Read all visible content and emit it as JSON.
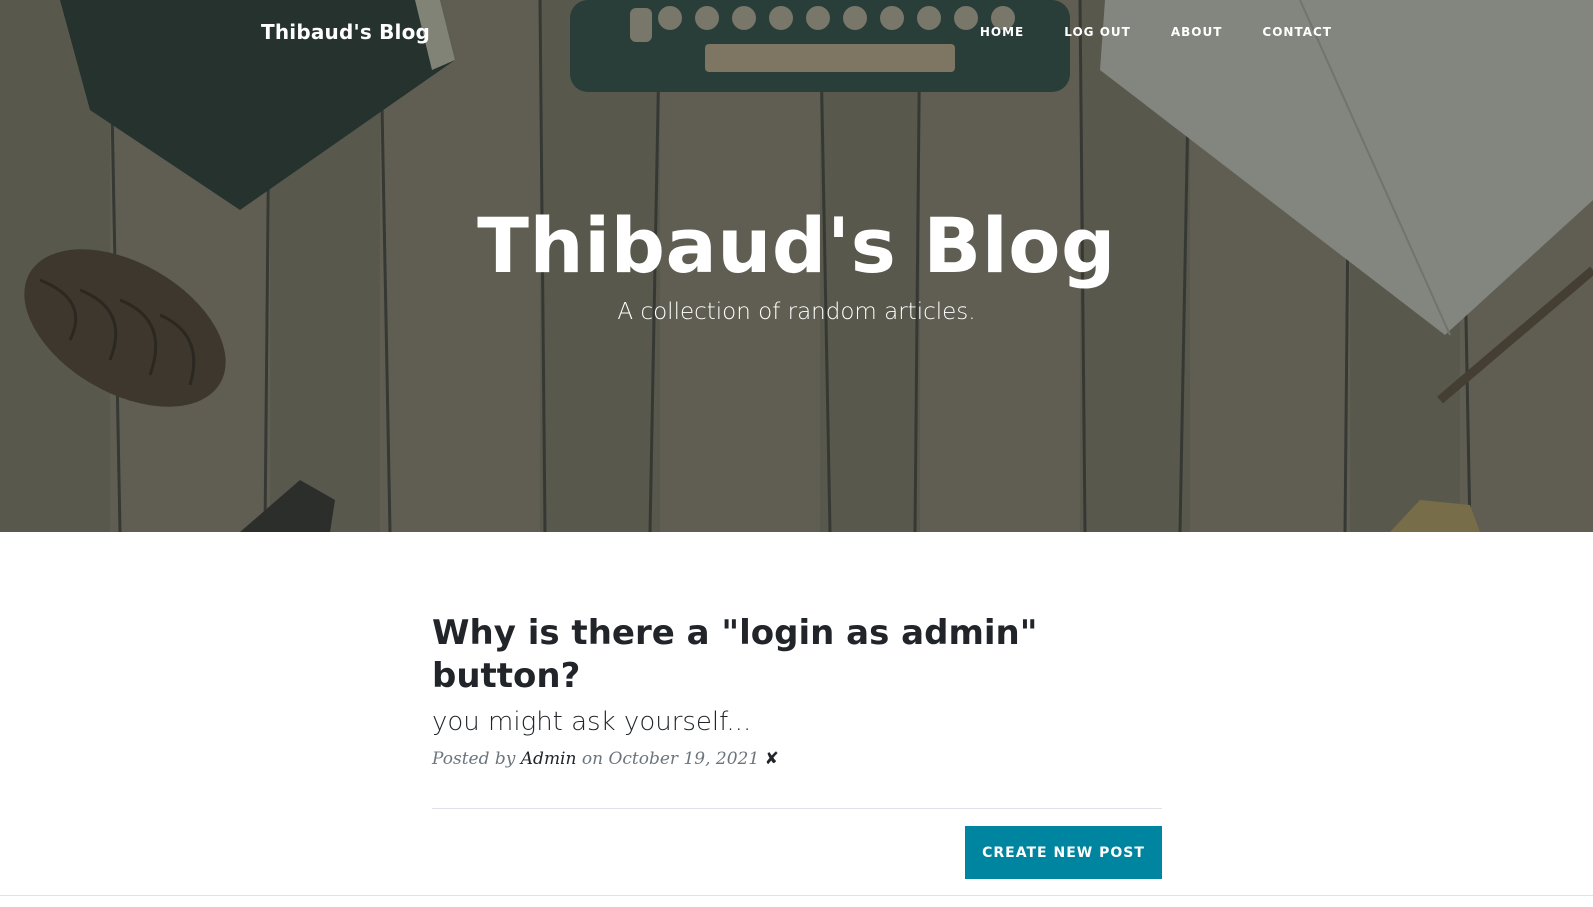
{
  "navbar": {
    "brand": "Thibaud's Blog",
    "links": [
      {
        "label": "HOME"
      },
      {
        "label": "LOG OUT"
      },
      {
        "label": "ABOUT"
      },
      {
        "label": "CONTACT"
      }
    ]
  },
  "hero": {
    "title": "Thibaud's Blog",
    "subtitle": "A collection of random articles."
  },
  "post": {
    "title": "Why is there a \"login as admin\" button?",
    "subtitle": "you might ask yourself...",
    "meta_prefix": "Posted by",
    "author": "Admin",
    "meta_on": "on",
    "date": "October 19, 2021",
    "delete_glyph": "✘"
  },
  "actions": {
    "create_label": "CREATE NEW POST"
  },
  "colors": {
    "accent": "#0085a1",
    "text": "#212529",
    "muted": "#6c757d"
  }
}
